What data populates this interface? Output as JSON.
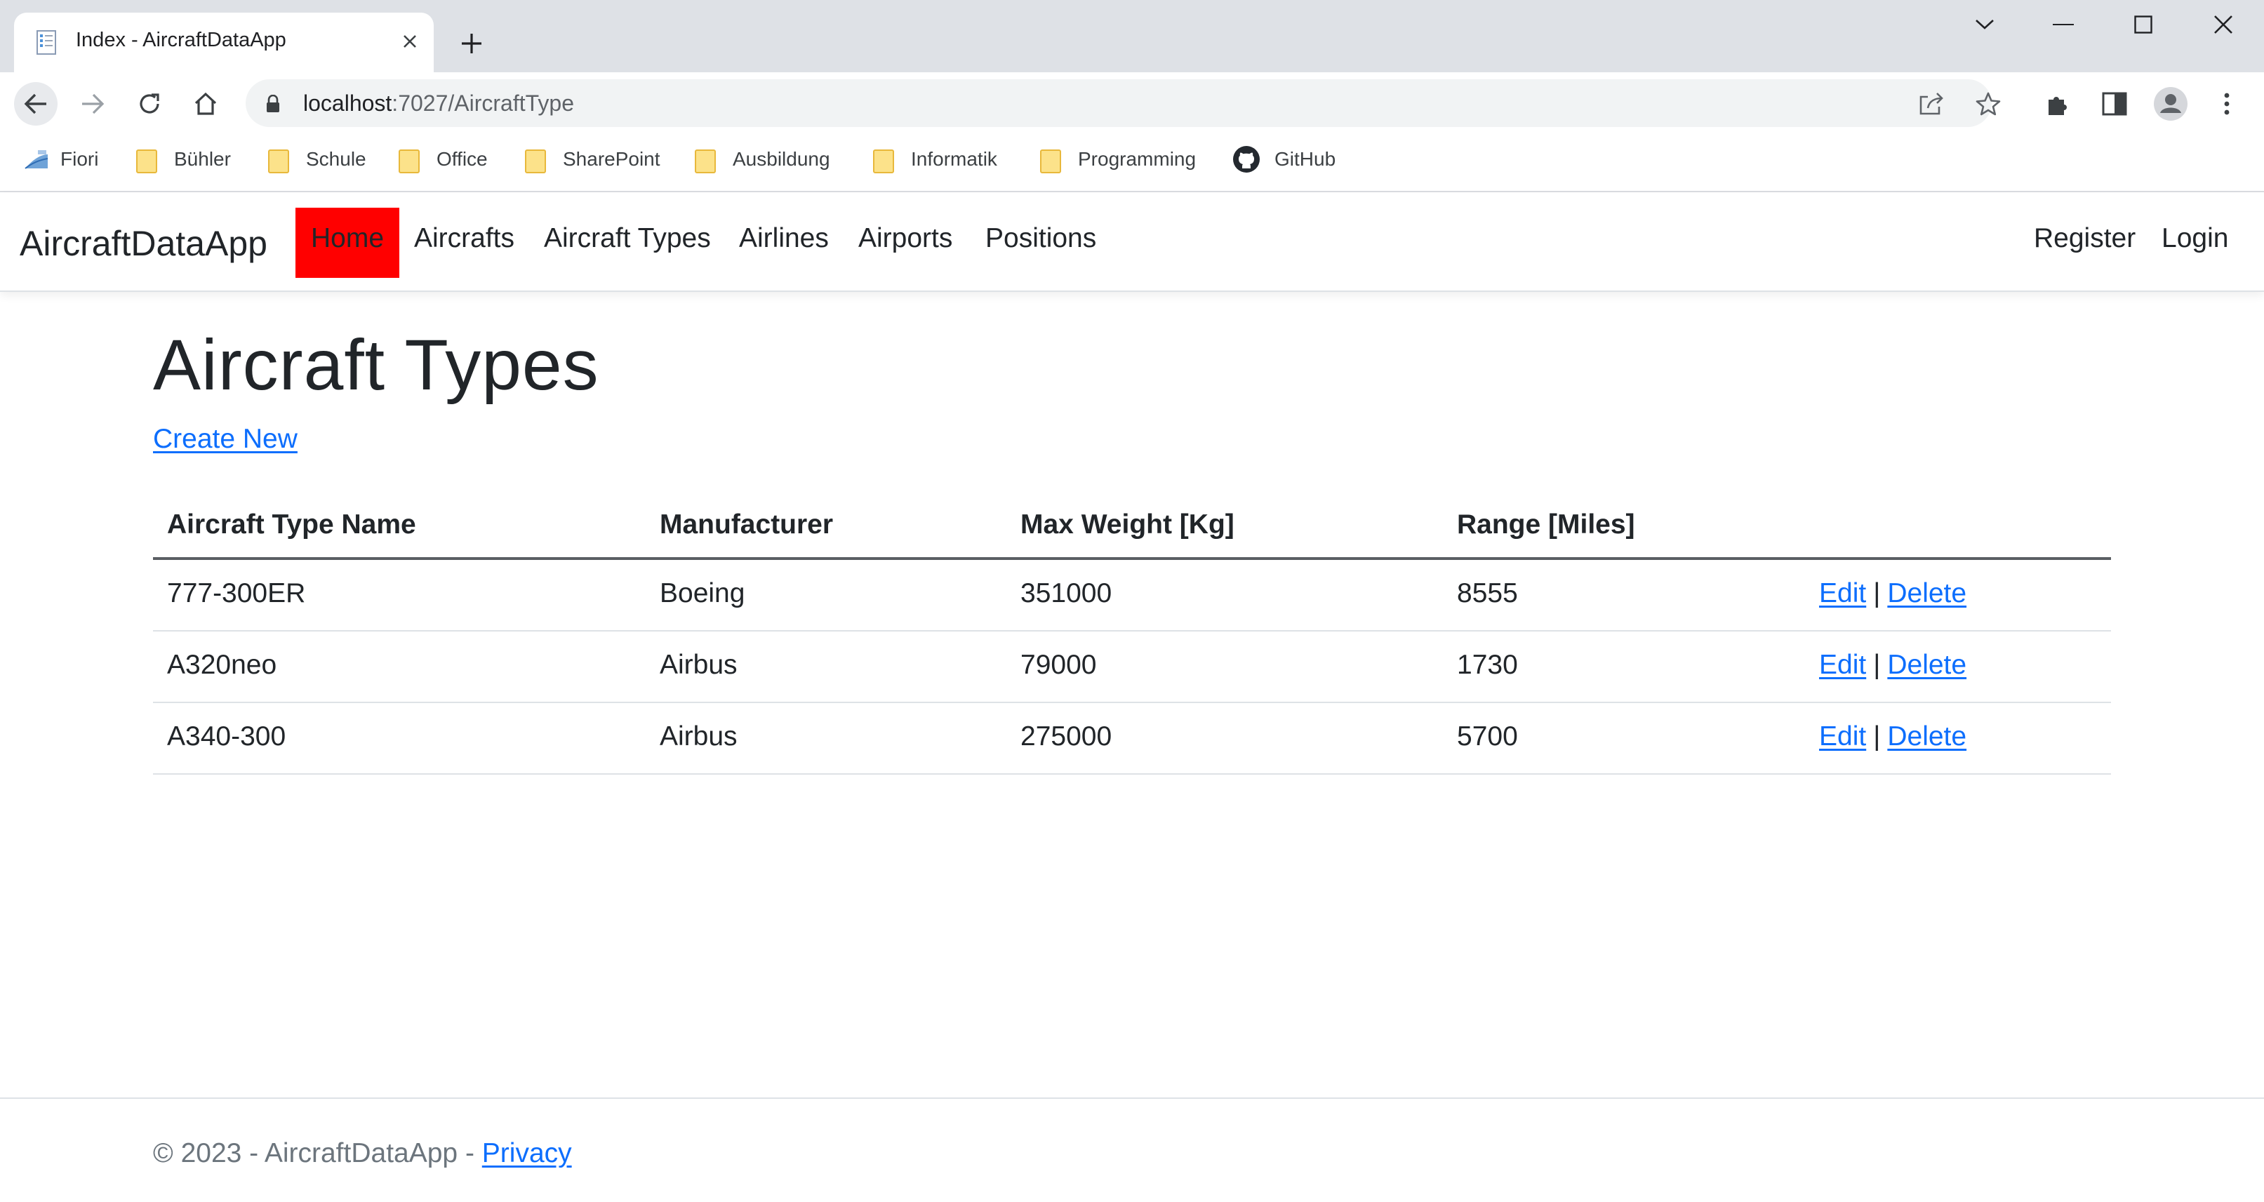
{
  "browser": {
    "tab": {
      "title": "Index - AircraftDataApp"
    },
    "address": {
      "host": "localhost",
      "path": ":7027/AircraftType"
    },
    "bookmarks": [
      {
        "label": "Fiori",
        "icon": "fiori-icon"
      },
      {
        "label": "Bühler",
        "icon": "folder-icon"
      },
      {
        "label": "Schule",
        "icon": "folder-icon"
      },
      {
        "label": "Office",
        "icon": "folder-icon"
      },
      {
        "label": "SharePoint",
        "icon": "folder-icon"
      },
      {
        "label": "Ausbildung",
        "icon": "folder-icon"
      },
      {
        "label": "Informatik",
        "icon": "folder-icon"
      },
      {
        "label": "Programming",
        "icon": "folder-icon"
      },
      {
        "label": "GitHub",
        "icon": "github-icon"
      }
    ]
  },
  "app": {
    "brand": "AircraftDataApp",
    "nav": [
      {
        "label": "Home",
        "active": true,
        "active_color": "#ff0000"
      },
      {
        "label": "Aircrafts"
      },
      {
        "label": "Aircraft Types"
      },
      {
        "label": "Airlines"
      },
      {
        "label": "Airports"
      },
      {
        "label": "Positions"
      }
    ],
    "auth": {
      "register": "Register",
      "login": "Login"
    }
  },
  "main": {
    "title": "Aircraft Types",
    "create_new": "Create New",
    "table": {
      "headers": [
        "Aircraft Type Name",
        "Manufacturer",
        "Max Weight [Kg]",
        "Range [Miles]"
      ],
      "rows": [
        {
          "name": "777-300ER",
          "manufacturer": "Boeing",
          "max_weight": "351000",
          "range": "8555"
        },
        {
          "name": "A320neo",
          "manufacturer": "Airbus",
          "max_weight": "79000",
          "range": "1730"
        },
        {
          "name": "A340-300",
          "manufacturer": "Airbus",
          "max_weight": "275000",
          "range": "5700"
        }
      ],
      "actions": {
        "edit": "Edit",
        "separator": "|",
        "delete": "Delete"
      }
    }
  },
  "footer": {
    "text": "© 2023 - AircraftDataApp - ",
    "privacy": "Privacy"
  },
  "colors": {
    "link": "#0d6efd",
    "active_nav": "#ff0000",
    "chrome_bg": "#dee1e6"
  }
}
